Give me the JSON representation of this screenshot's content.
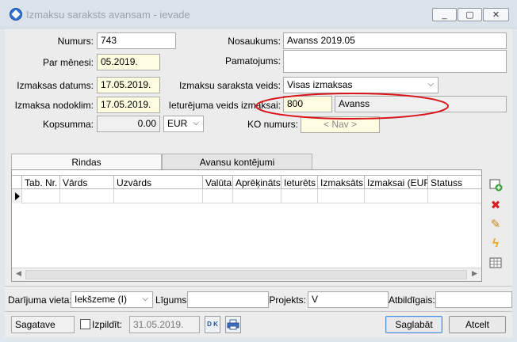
{
  "window": {
    "title": "Izmaksu saraksts avansam - ievade",
    "min_icon": "_",
    "max_icon": "▢",
    "close_icon": "✕"
  },
  "form": {
    "numurs": {
      "label": "Numurs:",
      "value": "743"
    },
    "par_menesi": {
      "label": "Par mēnesi:",
      "value": "05.2019."
    },
    "izmaksas_datums": {
      "label": "Izmaksas datums:",
      "value": "17.05.2019."
    },
    "izmaksa_nodoklim": {
      "label": "Izmaksa nodoklim:",
      "value": "17.05.2019."
    },
    "kopsumma": {
      "label": "Kopsumma:",
      "value": "0.00",
      "currency": "EUR"
    },
    "nosaukums": {
      "label": "Nosaukums:",
      "value": "Avanss 2019.05"
    },
    "pamatojums": {
      "label": "Pamatojums:",
      "value": ""
    },
    "saraksta_veids": {
      "label": "Izmaksu saraksta veids:",
      "value": "Visas izmaksas"
    },
    "ieturejuma_veids": {
      "label": "Ieturējuma veids izmaksai:",
      "code": "800",
      "name": "Avanss"
    },
    "ko_numurs": {
      "label": "KO numurs:",
      "value": "< Nav >"
    }
  },
  "tabs": [
    {
      "label": "Rindas",
      "active": true
    },
    {
      "label": "Avansu kontējumi",
      "active": false
    }
  ],
  "grid": {
    "columns": [
      "Tab. Nr.",
      "Vārds",
      "Uzvārds",
      "Valūta",
      "Aprēķināts",
      "Ieturēts",
      "Izmaksāts",
      "Izmaksai (EUR)",
      "Statuss"
    ]
  },
  "side_icons": [
    "add-row-icon",
    "delete-row-icon",
    "edit-icon",
    "lightning-icon",
    "columns-icon"
  ],
  "bottom": {
    "darijuma_vieta": {
      "label": "Darījuma vieta:",
      "value": "Iekšzeme (I)"
    },
    "ligums": {
      "label": "Līgums:",
      "value": ""
    },
    "projekts": {
      "label": "Projekts:",
      "value": "V"
    },
    "atbildigais": {
      "label": "Atbildīgais:",
      "value": ""
    }
  },
  "footer": {
    "status": "Sagatave",
    "izpildit_label": "Izpildīt:",
    "izpildit_date": "31.05.2019.",
    "dk_label": "D K",
    "save_label": "Saglabāt",
    "cancel_label": "Atcelt"
  },
  "colors": {
    "annotation_ellipse": "#d9141b",
    "accent": "#2f6fd6"
  }
}
